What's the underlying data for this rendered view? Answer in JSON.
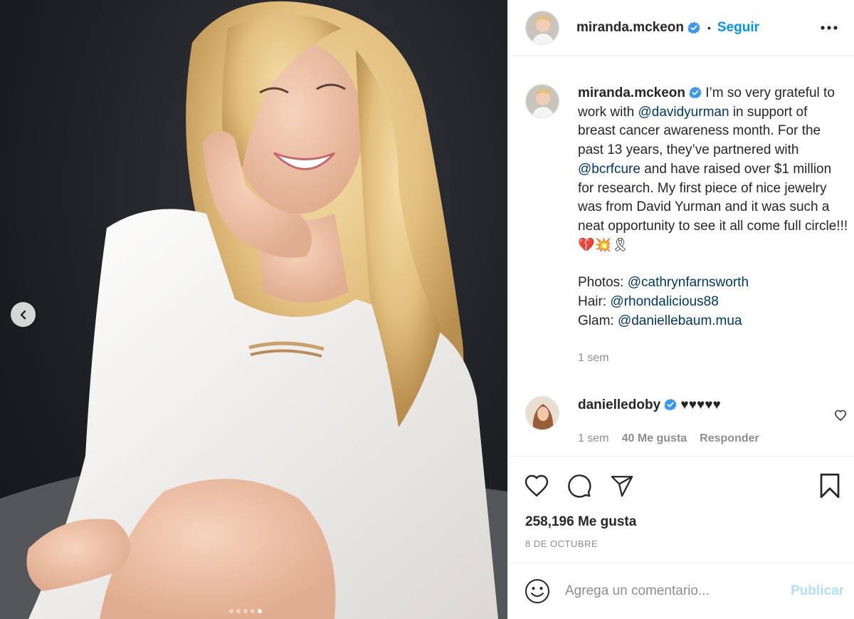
{
  "post": {
    "author": "miranda.mckeon",
    "follow_label": "Seguir",
    "separator": "•",
    "caption": {
      "segments": [
        {
          "type": "text",
          "value": "I’m so very grateful to work with "
        },
        {
          "type": "mention",
          "value": "@davidyurman"
        },
        {
          "type": "text",
          "value": " in support of breast cancer awareness month. For the past 13 years, they’ve partnered with "
        },
        {
          "type": "mention",
          "value": "@bcrfcure"
        },
        {
          "type": "text",
          "value": " and have raised over $1 million for research. My first piece of nice jewelry was from David Yurman and it was such a neat opportunity to see it all come full circle!!! 💔💥🎗"
        }
      ],
      "credits": [
        {
          "label": "Photos: ",
          "mention": "@cathrynfarnsworth"
        },
        {
          "label": "Hair: ",
          "mention": "@rhondalicious88"
        },
        {
          "label": "Glam: ",
          "mention": "@daniellebaum.mua"
        }
      ],
      "time": "1 sem"
    },
    "comments": [
      {
        "username": "danielledoby",
        "text": "♥♥♥♥♥",
        "time": "1 sem",
        "likes": "40 Me gusta",
        "reply_label": "Responder"
      }
    ],
    "likes_text": "258,196 Me gusta",
    "date": "8 DE OCTUBRE",
    "add_comment": {
      "placeholder": "Agrega un comentario...",
      "publish_label": "Publicar"
    },
    "carousel": {
      "total": 5,
      "current": 5
    }
  },
  "colors": {
    "link": "#00376b",
    "follow": "#0095f6",
    "publish_disabled": "#b2dffc",
    "verified": "#3897f0",
    "meta": "#8e8e8e"
  },
  "icons": {
    "prev": "chevron-left-icon",
    "more": "more-horizontal-icon",
    "like": "heart-icon",
    "comment": "comment-icon",
    "share": "paper-plane-icon",
    "save": "bookmark-icon",
    "emoji": "smiley-icon",
    "verified": "verified-badge-icon"
  }
}
